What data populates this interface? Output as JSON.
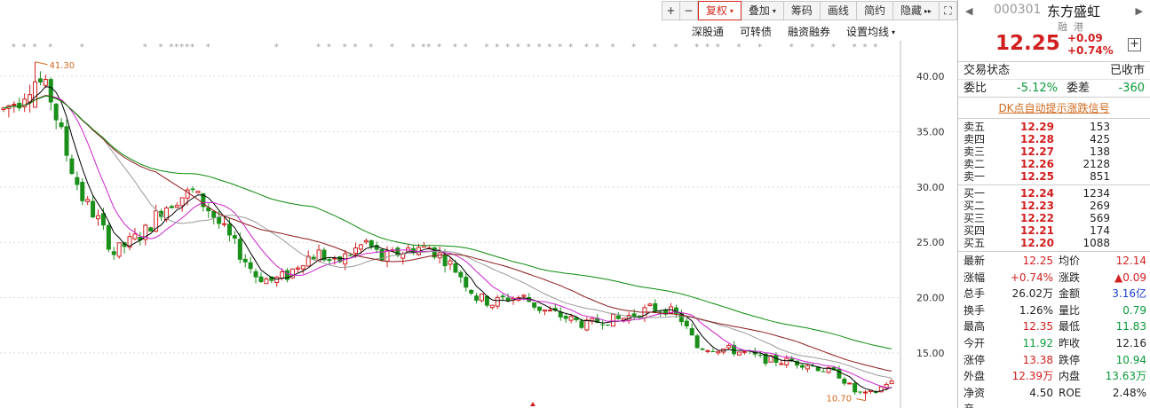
{
  "toolbar": {
    "plus": "+",
    "minus": "−",
    "fuquan": "复权",
    "diejia": "叠加",
    "chouma": "筹码",
    "huaxian": "画线",
    "jianyue": "简约",
    "yincang": "隐藏",
    "caret": "▾",
    "double_arrow": "▸▸",
    "expand": "⛶"
  },
  "options": {
    "shengutong": "深股通",
    "kezhuanzhai": "可转债",
    "rongzirongquan": "融资融券",
    "junxian": "设置均线"
  },
  "chart_data": {
    "type": "candlestick",
    "ylim": [
      10,
      43
    ],
    "y_ticks": [
      "40.00",
      "35.00",
      "30.00",
      "25.00",
      "20.00",
      "15.00"
    ],
    "y_tick_values": [
      40,
      35,
      30,
      25,
      20,
      15
    ],
    "annotations": [
      {
        "text": "41.30",
        "value": 41.3
      },
      {
        "text": "10.70",
        "value": 10.7
      }
    ],
    "anchors": [
      [
        0,
        37
      ],
      [
        3,
        38
      ],
      [
        6,
        40
      ],
      [
        9,
        38
      ],
      [
        12,
        33
      ],
      [
        15,
        29
      ],
      [
        18,
        27
      ],
      [
        21,
        24
      ],
      [
        24,
        25
      ],
      [
        27,
        26
      ],
      [
        30,
        28
      ],
      [
        33,
        29
      ],
      [
        36,
        29.5
      ],
      [
        39,
        28
      ],
      [
        42,
        26
      ],
      [
        45,
        24
      ],
      [
        48,
        22
      ],
      [
        51,
        21.5
      ],
      [
        54,
        22
      ],
      [
        57,
        23.5
      ],
      [
        60,
        24
      ],
      [
        63,
        23
      ],
      [
        66,
        24
      ],
      [
        69,
        25
      ],
      [
        72,
        23.5
      ],
      [
        75,
        24
      ],
      [
        78,
        24.5
      ],
      [
        81,
        24.5
      ],
      [
        84,
        23.5
      ],
      [
        87,
        22
      ],
      [
        90,
        20
      ],
      [
        93,
        19.5
      ],
      [
        96,
        20
      ],
      [
        99,
        20
      ],
      [
        102,
        19
      ],
      [
        105,
        18.5
      ],
      [
        108,
        18
      ],
      [
        111,
        17.5
      ],
      [
        114,
        18
      ],
      [
        117,
        18
      ],
      [
        120,
        18.5
      ],
      [
        123,
        19
      ],
      [
        126,
        19
      ],
      [
        129,
        18
      ],
      [
        132,
        15.5
      ],
      [
        135,
        15.5
      ],
      [
        138,
        15.3
      ],
      [
        141,
        15
      ],
      [
        144,
        14.5
      ],
      [
        147,
        14.3
      ],
      [
        150,
        14.2
      ],
      [
        153,
        14
      ],
      [
        156,
        13.5
      ],
      [
        159,
        13
      ],
      [
        162,
        11.5
      ],
      [
        164,
        11.2
      ],
      [
        166,
        11.5
      ],
      [
        168,
        12.3
      ]
    ],
    "ma_series": [
      {
        "color": "#000000",
        "period": 5
      },
      {
        "color": "#cc22cc",
        "period": 10
      },
      {
        "color": "#999999",
        "period": 20
      },
      {
        "color": "#8b1a1a",
        "period": 30
      },
      {
        "color": "#0a8a0a",
        "period": 60
      }
    ]
  },
  "panel": {
    "code": "000301",
    "name": "东方盛虹",
    "tag_margin": "融",
    "tag_hk": "港",
    "price": "12.25",
    "change": "+0.09",
    "change_pct": "+0.74%",
    "add": "+",
    "prev": "◀",
    "next": "▶",
    "trade_status_label": "交易状态",
    "trade_status_value": "已收市",
    "weibi_label": "委比",
    "weibi_value": "-5.12%",
    "weicha_label": "委差",
    "weicha_value": "-360",
    "signal_link": "DK点自动提示涨跌信号",
    "asks": [
      {
        "label": "卖五",
        "price": "12.29",
        "vol": "153"
      },
      {
        "label": "卖四",
        "price": "12.28",
        "vol": "425"
      },
      {
        "label": "卖三",
        "price": "12.27",
        "vol": "138"
      },
      {
        "label": "卖二",
        "price": "12.26",
        "vol": "2128"
      },
      {
        "label": "卖一",
        "price": "12.25",
        "vol": "851"
      }
    ],
    "bids": [
      {
        "label": "买一",
        "price": "12.24",
        "vol": "1234"
      },
      {
        "label": "买二",
        "price": "12.23",
        "vol": "269"
      },
      {
        "label": "买三",
        "price": "12.22",
        "vol": "569"
      },
      {
        "label": "买四",
        "price": "12.21",
        "vol": "174"
      },
      {
        "label": "买五",
        "price": "12.20",
        "vol": "1088"
      }
    ],
    "stats": [
      {
        "k": "最新",
        "v": "12.25",
        "vc": "red",
        "k2": "均价",
        "v2": "12.14",
        "v2c": "red"
      },
      {
        "k": "涨幅",
        "v": "+0.74%",
        "vc": "red",
        "k2": "涨跌",
        "v2": "▲0.09",
        "v2c": "red"
      },
      {
        "k": "总手",
        "v": "26.02万",
        "vc": "dark",
        "k2": "金额",
        "v2": "3.16亿",
        "v2c": "blue"
      },
      {
        "k": "换手",
        "v": "1.26%",
        "vc": "dark",
        "k2": "量比",
        "v2": "0.79",
        "v2c": "green"
      },
      {
        "k": "最高",
        "v": "12.35",
        "vc": "red",
        "k2": "最低",
        "v2": "11.83",
        "v2c": "green"
      },
      {
        "k": "今开",
        "v": "11.92",
        "vc": "green",
        "k2": "昨收",
        "v2": "12.16",
        "v2c": "dark"
      },
      {
        "k": "涨停",
        "v": "13.38",
        "vc": "red",
        "k2": "跌停",
        "v2": "10.94",
        "v2c": "green"
      },
      {
        "k": "外盘",
        "v": "12.39万",
        "vc": "red",
        "k2": "内盘",
        "v2": "13.63万",
        "v2c": "green"
      },
      {
        "k": "净资产",
        "v": "4.50",
        "vc": "dark",
        "k2": "ROE",
        "v2": "2.48%",
        "v2c": "dark"
      }
    ]
  },
  "colors": {
    "up": "#d11f1f",
    "down": "#1a8f1a",
    "grid": "#d8d8d8"
  }
}
